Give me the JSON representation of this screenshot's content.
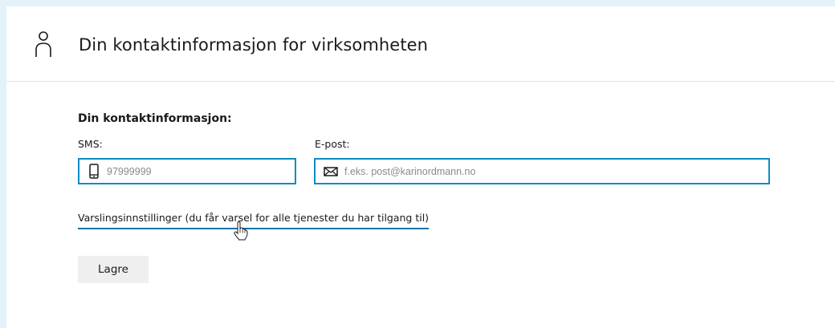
{
  "header": {
    "icon": "person-icon",
    "title": "Din kontaktinformasjon for virksomheten"
  },
  "form": {
    "heading": "Din kontaktinformasjon:",
    "sms": {
      "label": "SMS:",
      "icon": "mobile-phone-icon",
      "placeholder": "97999999",
      "value": ""
    },
    "email": {
      "label": "E-post:",
      "icon": "envelope-icon",
      "placeholder": "f.eks. post@karinordmann.no",
      "value": ""
    },
    "notification_link": "Varslingsinnstillinger (du får varsel for alle tjenester du har tilgang til)",
    "save_label": "Lagre"
  },
  "colors": {
    "accent": "#0d8bc4",
    "frame": "#e3f2f8",
    "button_bg": "#efefef"
  }
}
